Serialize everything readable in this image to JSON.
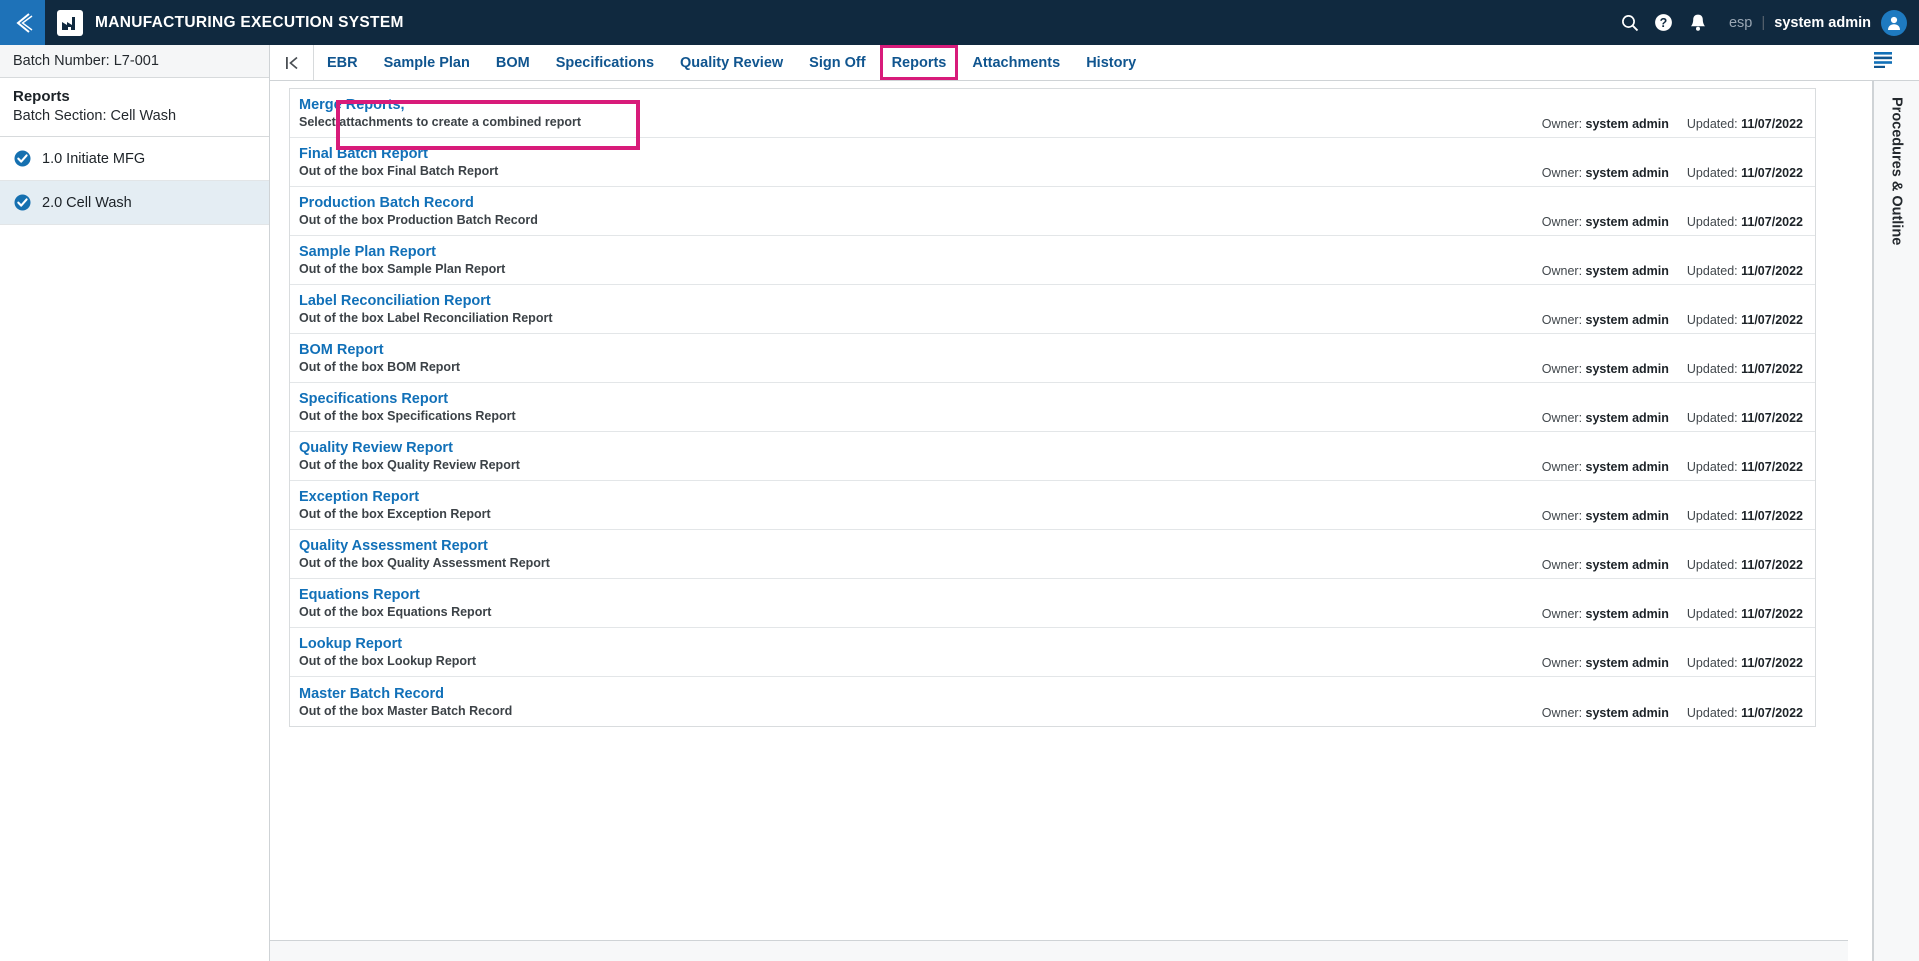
{
  "header": {
    "title": "MANUFACTURING EXECUTION SYSTEM",
    "back_icon": "back-chevron-icon",
    "app_icon": "factory-icon",
    "search_icon": "search-icon",
    "help_icon": "help-circle-icon",
    "notification_icon": "bell-icon",
    "language": "esp",
    "separator": "|",
    "username": "system admin",
    "avatar_icon": "user-avatar-icon"
  },
  "sidebar": {
    "batch_number": "Batch Number: L7-001",
    "section_title": "Reports",
    "section_subtitle": "Batch Section: Cell Wash",
    "items": [
      {
        "label": "1.0 Initiate MFG",
        "icon": "check-circle-icon",
        "selected": false
      },
      {
        "label": "2.0 Cell Wash",
        "icon": "check-circle-icon",
        "selected": true
      }
    ]
  },
  "tabbar": {
    "collapse_icon": "collapse-left-icon",
    "tabs": [
      {
        "label": "EBR",
        "highlighted": false
      },
      {
        "label": "Sample Plan",
        "highlighted": false
      },
      {
        "label": "BOM",
        "highlighted": false
      },
      {
        "label": "Specifications",
        "highlighted": false
      },
      {
        "label": "Quality Review",
        "highlighted": false
      },
      {
        "label": "Sign Off",
        "highlighted": false
      },
      {
        "label": "Reports",
        "highlighted": true
      },
      {
        "label": "Attachments",
        "highlighted": false
      },
      {
        "label": "History",
        "highlighted": false
      }
    ]
  },
  "main": {
    "owner_label": "Owner:",
    "updated_label": "Updated:",
    "reports": [
      {
        "title": "Merge Reports,",
        "description": "Select attachments to create a combined report",
        "owner": "system admin",
        "updated": "11/07/2022",
        "highlighted": true
      },
      {
        "title": "Final Batch Report",
        "description": "Out of the box Final Batch Report",
        "owner": "system admin",
        "updated": "11/07/2022",
        "highlighted": false
      },
      {
        "title": "Production Batch Record",
        "description": "Out of the box Production Batch Record",
        "owner": "system admin",
        "updated": "11/07/2022",
        "highlighted": false
      },
      {
        "title": "Sample Plan Report",
        "description": "Out of the box Sample Plan Report",
        "owner": "system admin",
        "updated": "11/07/2022",
        "highlighted": false
      },
      {
        "title": "Label Reconciliation Report",
        "description": "Out of the box Label Reconciliation Report",
        "owner": "system admin",
        "updated": "11/07/2022",
        "highlighted": false
      },
      {
        "title": "BOM Report",
        "description": "Out of the box BOM Report",
        "owner": "system admin",
        "updated": "11/07/2022",
        "highlighted": false
      },
      {
        "title": "Specifications Report",
        "description": "Out of the box Specifications Report",
        "owner": "system admin",
        "updated": "11/07/2022",
        "highlighted": false
      },
      {
        "title": "Quality Review Report",
        "description": "Out of the box Quality Review Report",
        "owner": "system admin",
        "updated": "11/07/2022",
        "highlighted": false
      },
      {
        "title": "Exception Report",
        "description": "Out of the box Exception Report",
        "owner": "system admin",
        "updated": "11/07/2022",
        "highlighted": false
      },
      {
        "title": "Quality Assessment Report",
        "description": "Out of the box Quality Assessment Report",
        "owner": "system admin",
        "updated": "11/07/2022",
        "highlighted": false
      },
      {
        "title": "Equations Report",
        "description": "Out of the box Equations Report",
        "owner": "system admin",
        "updated": "11/07/2022",
        "highlighted": false
      },
      {
        "title": "Lookup Report",
        "description": "Out of the box Lookup Report",
        "owner": "system admin",
        "updated": "11/07/2022",
        "highlighted": false
      },
      {
        "title": "Master Batch Record",
        "description": "Out of the box Master Batch Record",
        "owner": "system admin",
        "updated": "11/07/2022",
        "highlighted": false
      }
    ]
  },
  "rail": {
    "icon": "list-lines-icon",
    "label": "Procedures & Outline"
  },
  "colors": {
    "header_bg": "#10293f",
    "accent_blue": "#1e72b8",
    "link_blue": "#1170b8",
    "tab_blue": "#10558f",
    "highlight_magenta": "#d81b7a",
    "selected_row": "#e4edf3"
  }
}
